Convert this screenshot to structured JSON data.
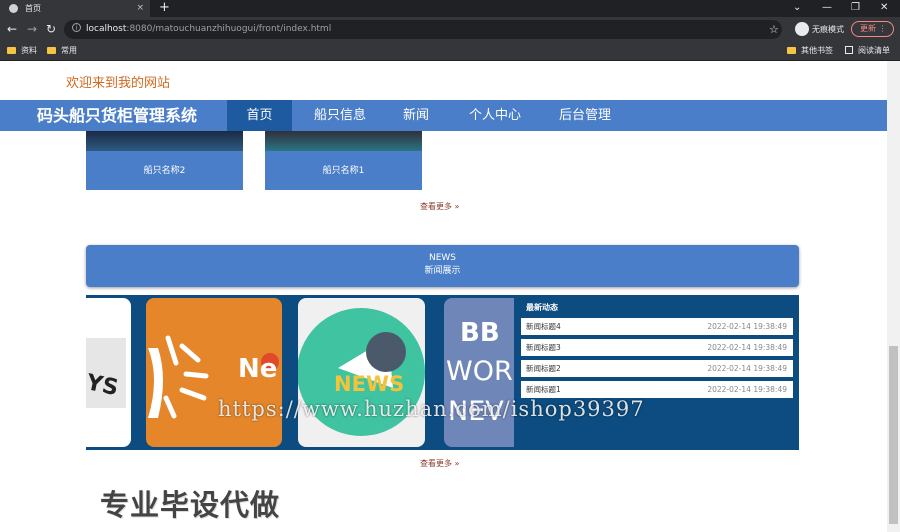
{
  "browser": {
    "tab_title": "首页",
    "tab_close": "×",
    "new_tab": "+",
    "window_controls": [
      "⌄",
      "—",
      "❐",
      "✕"
    ],
    "url_host": "localhost",
    "url_path": ":8080/matouchuanzhihuogui/front/index.html",
    "incognito_label": "无痕模式",
    "update_label": "更新",
    "bookmarks": [
      "资料",
      "常用"
    ],
    "bookmarks_right": [
      "其他书签",
      "阅读清单"
    ]
  },
  "page": {
    "welcome": "欢迎来到我的网站",
    "site_title": "码头船只货柜管理系统",
    "nav": [
      "首页",
      "船只信息",
      "新闻",
      "个人中心",
      "后台管理"
    ],
    "ships": [
      "船只名称2",
      "船只名称1"
    ],
    "more_label": "查看更多",
    "more_arrow": "»",
    "news_en": "NEWS",
    "news_cn": "新闻展示",
    "thumb_text_1": "NEWS",
    "thumb_text_2": "BB",
    "thumb_text_3": "WOR",
    "thumb_text_4": "NEV",
    "latest_title": "最新动态",
    "news": [
      {
        "title": "新闻标题4",
        "date": "2022-02-14 19:38:49"
      },
      {
        "title": "新闻标题3",
        "date": "2022-02-14 19:38:49"
      },
      {
        "title": "新闻标题2",
        "date": "2022-02-14 19:38:49"
      },
      {
        "title": "新闻标题1",
        "date": "2022-02-14 19:38:49"
      }
    ],
    "more_label_2": "查看更多",
    "watermark": "https://www.huzhan.com/ishop39397",
    "footer_text": "专业毕设代做"
  },
  "colors": {
    "nav_bg": "#4a7ec8",
    "nav_active": "#1e5aa0",
    "news_panel": "#0c4c80",
    "welcome": "#d2691e"
  }
}
